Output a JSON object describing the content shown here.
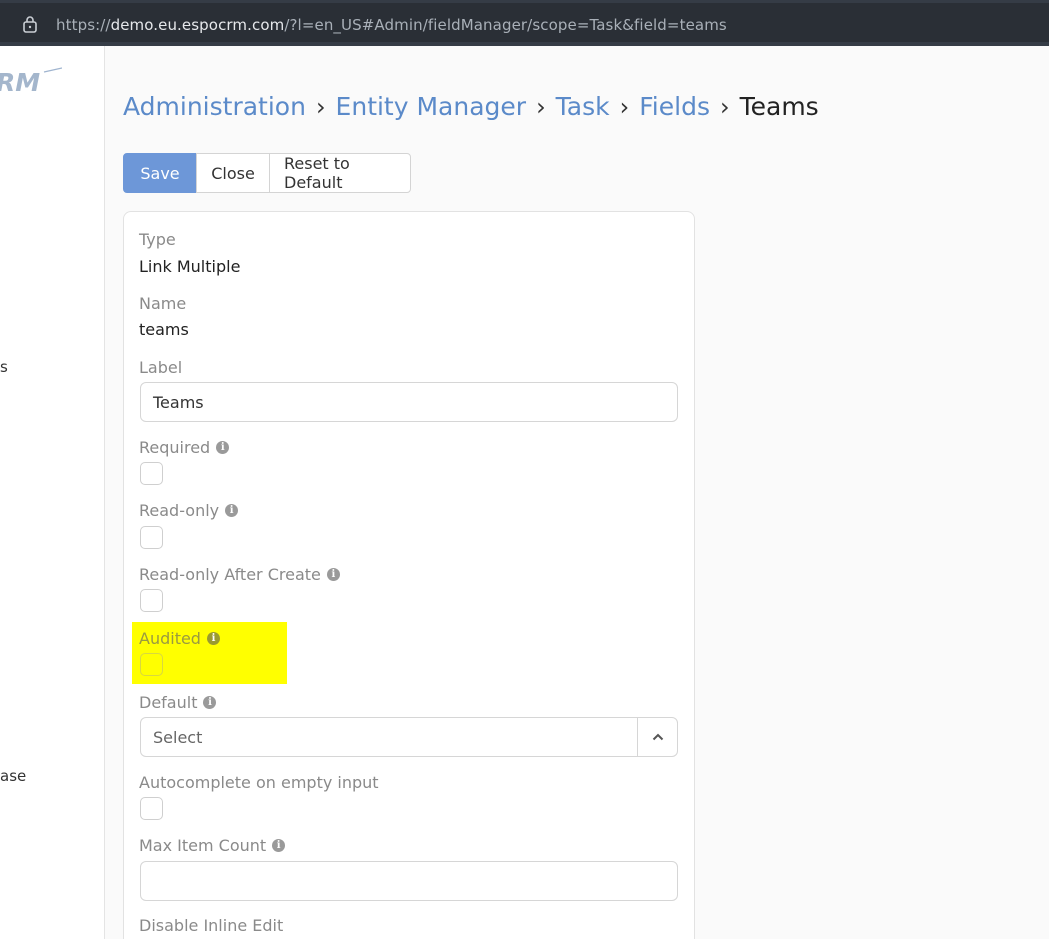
{
  "browser": {
    "url_prefix": "https://",
    "url_host": "demo.eu.espocrm.com",
    "url_rest": "/?l=en_US#Admin/fieldManager/scope=Task&field=teams"
  },
  "sidebar": {
    "logo_text": "RM",
    "fragment_1": "s",
    "fragment_2": "ase"
  },
  "breadcrumb": {
    "items": [
      "Administration",
      "Entity Manager",
      "Task",
      "Fields"
    ],
    "separator": "›",
    "current": "Teams"
  },
  "toolbar": {
    "save_label": "Save",
    "close_label": "Close",
    "reset_label": "Reset to Default"
  },
  "fields": {
    "type": {
      "label": "Type",
      "value": "Link Multiple"
    },
    "name": {
      "label": "Name",
      "value": "teams"
    },
    "label": {
      "label": "Label",
      "value": "Teams"
    },
    "required": {
      "label": "Required",
      "checked": false
    },
    "read_only": {
      "label": "Read-only",
      "checked": false
    },
    "read_only_after_create": {
      "label": "Read-only After Create",
      "checked": false
    },
    "audited": {
      "label": "Audited",
      "checked": false
    },
    "default": {
      "label": "Default",
      "placeholder": "Select"
    },
    "autocomplete_on_empty": {
      "label": "Autocomplete on empty input",
      "checked": false
    },
    "max_item_count": {
      "label": "Max Item Count",
      "value": ""
    },
    "disable_inline_edit": {
      "label": "Disable Inline Edit"
    }
  },
  "colors": {
    "accent": "#6d97d8",
    "link": "#5b8ac9",
    "highlight": "#ffff00"
  }
}
